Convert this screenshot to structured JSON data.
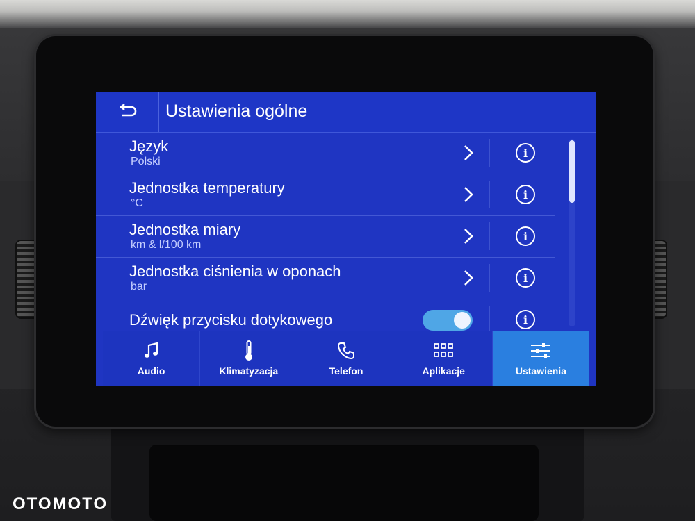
{
  "header": {
    "title": "Ustawienia ogólne"
  },
  "settings": [
    {
      "title": "Język",
      "subtitle": "Polski"
    },
    {
      "title": "Jednostka temperatury",
      "subtitle": "°C"
    },
    {
      "title": "Jednostka miary",
      "subtitle": "km & l/100 km"
    },
    {
      "title": "Jednostka ciśnienia w oponach",
      "subtitle": "bar"
    },
    {
      "title": "Dźwięk przycisku dotykowego",
      "toggle_on": true
    }
  ],
  "info_glyph": "i",
  "tabs": [
    {
      "label": "Audio",
      "icon": "music-note-icon"
    },
    {
      "label": "Klimatyzacja",
      "icon": "thermometer-icon"
    },
    {
      "label": "Telefon",
      "icon": "phone-icon"
    },
    {
      "label": "Aplikacje",
      "icon": "grid-icon"
    },
    {
      "label": "Ustawienia",
      "icon": "sliders-icon",
      "active": true
    }
  ],
  "colors": {
    "screen_bg": "#1f35c2",
    "active_tab": "#2a7fe0",
    "toggle_on": "#4fa6e6"
  },
  "watermark": "OTOMOTO"
}
